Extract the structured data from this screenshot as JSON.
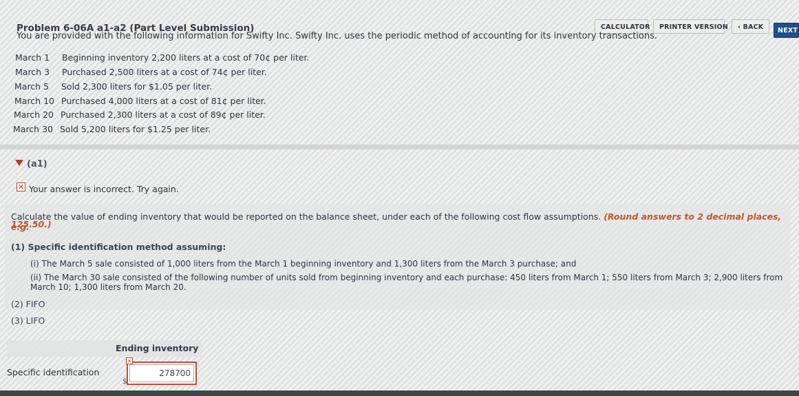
{
  "header": {
    "title": "Problem 6-06A a1-a2 (Part Level Submission)",
    "buttons": {
      "calculator": "CALCULATOR",
      "printer": "PRINTER VERSION",
      "back": "BACK",
      "next": "NEXT"
    }
  },
  "intro": "You are provided with the following information for Swifty Inc. Swifty Inc. uses the periodic method of accounting for its inventory transactions.",
  "transactions": [
    {
      "date": "March  1",
      "text": "Beginning inventory 2,200 liters at a cost of 70¢ per liter."
    },
    {
      "date": "March  3",
      "text": "Purchased 2,500 liters at a cost of 74¢ per liter."
    },
    {
      "date": "March  5",
      "text": "Sold 2,300 liters for $1.05 per liter."
    },
    {
      "date": "March 10",
      "text": "Purchased 4,000 liters at a cost of 81¢ per liter."
    },
    {
      "date": "March 20",
      "text": "Purchased 2,300 liters at a cost of 89¢ per liter."
    },
    {
      "date": "March 30",
      "text": "Sold 5,200 liters for $1.25 per liter."
    }
  ],
  "section": {
    "label": "(a1)"
  },
  "feedback": {
    "message": "Your answer is incorrect.  Try again."
  },
  "question": {
    "text": "Calculate the value of ending inventory that would be reported on the balance sheet, under each of the following cost flow assumptions. ",
    "round_note": "(Round answers to 2 decimal places, e.g.",
    "example": "125.50.)",
    "sub1": "(1) Specific identification method assuming:",
    "sub1_i": "(i)  The March 5 sale consisted of 1,000 liters from the March 1 beginning inventory and 1,300 liters from the March 3 purchase; and",
    "sub1_ii": "(ii) The March 30 sale consisted of the following number of units sold from beginning inventory and each purchase: 450 liters from March 1; 550 liters from March 3; 2,900 liters from March 10; 1,300 liters from March 20.",
    "sub2": "(2) FIFO",
    "sub3": "(3) LIFO"
  },
  "table": {
    "column_header": "Ending inventory",
    "rows": [
      {
        "label": "Specific identification",
        "currency": "$",
        "value": "278700"
      }
    ]
  },
  "colors": {
    "accent_orange": "#c0582a",
    "error_red": "#c23b2e",
    "next_blue": "#1d4f8a"
  }
}
